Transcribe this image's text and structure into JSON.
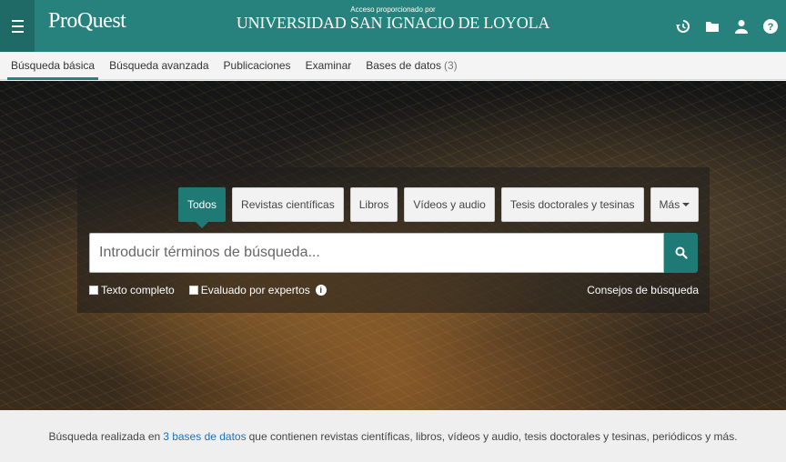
{
  "header": {
    "logo": "ProQuest",
    "access_label": "Acceso proporcionado por",
    "institution": "UNIVERSIDAD SAN IGNACIO DE LOYOLA",
    "color": "#27817c",
    "icons": [
      "history-icon",
      "folder-icon",
      "user-icon",
      "help-icon"
    ]
  },
  "nav": {
    "items": [
      {
        "label": "Búsqueda básica"
      },
      {
        "label": "Búsqueda avanzada"
      },
      {
        "label": "Publicaciones"
      },
      {
        "label": "Examinar"
      },
      {
        "label": "Bases de datos",
        "count": "(3)"
      }
    ]
  },
  "search": {
    "tabs": [
      {
        "label": "Todos"
      },
      {
        "label": "Revistas científicas"
      },
      {
        "label": "Libros"
      },
      {
        "label": "Vídeos y audio"
      },
      {
        "label": "Tesis doctorales y tesinas"
      },
      {
        "label": "Más"
      }
    ],
    "placeholder": "Introducir términos de búsqueda...",
    "full_text_label": "Texto completo",
    "peer_reviewed_label": "Evaluado por expertos",
    "tips_label": "Consejos de búsqueda"
  },
  "footer": {
    "prefix": "Búsqueda realizada en",
    "link": "3 bases de datos",
    "suffix": "que contienen revistas científicas, libros, vídeos y audio, tesis doctorales y tesinas, periódicos y más."
  }
}
